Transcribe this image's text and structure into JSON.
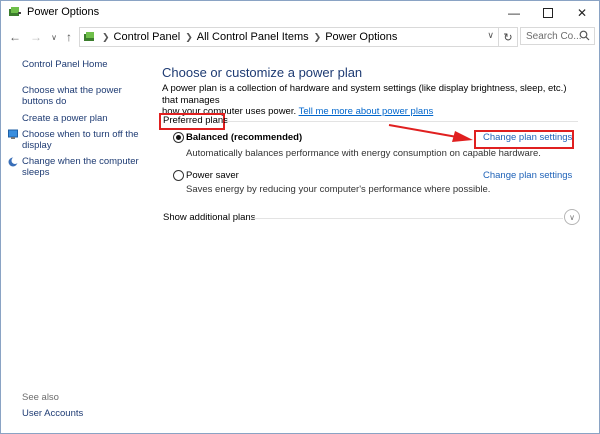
{
  "window": {
    "title": "Power Options"
  },
  "address": {
    "crumbs": [
      "Control Panel",
      "All Control Panel Items",
      "Power Options"
    ],
    "search_placeholder": "Search Co..."
  },
  "sidebar": {
    "home": "Control Panel Home",
    "links": [
      {
        "label_line1": "Choose what the power",
        "label_line2": "buttons do",
        "icon": ""
      },
      {
        "label_line1": "Create a power plan",
        "label_line2": "",
        "icon": ""
      },
      {
        "label_line1": "Choose when to turn off the",
        "label_line2": "display",
        "icon": "display-icon"
      },
      {
        "label_line1": "Change when the computer",
        "label_line2": "sleeps",
        "icon": "moon-icon"
      }
    ],
    "see_also": "See also",
    "user_accounts": "User Accounts"
  },
  "main": {
    "heading": "Choose or customize a power plan",
    "intro_line1": "A power plan is a collection of hardware and system settings (like display brightness, sleep, etc.) that manages",
    "intro_line2": "how your computer uses power.",
    "intro_link": "Tell me more about power plans",
    "preferred_label": "Preferred plans",
    "plans": [
      {
        "name": "Balanced (recommended)",
        "desc": "Automatically balances performance with energy consumption on capable hardware.",
        "selected": true,
        "link": "Change plan settings"
      },
      {
        "name": "Power saver",
        "desc": "Saves energy by reducing your computer's performance where possible.",
        "selected": false,
        "link": "Change plan settings"
      }
    ],
    "show_more": "Show additional plans"
  },
  "colors": {
    "annotation": "#e02020",
    "link": "#1e62b8",
    "heading": "#1e3b73"
  }
}
